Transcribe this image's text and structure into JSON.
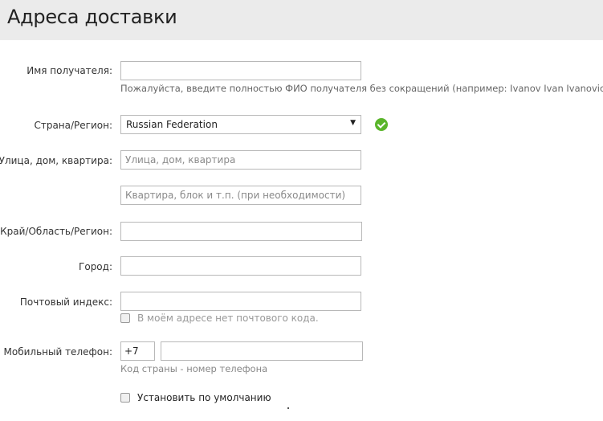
{
  "header": {
    "title": "Адреса доставки"
  },
  "form": {
    "recipient_label": "Имя получателя:",
    "recipient_value": "",
    "recipient_hint": "Пожалуйста, введите полностью ФИО получателя без сокращений (например: Ivanov Ivan Ivanovich).",
    "country_label": "Страна/Регион:",
    "country_value": "Russian Federation",
    "street_label": "Улица, дом, квартира:",
    "street_placeholder": "Улица, дом, квартира",
    "apartment_placeholder": "Квартира, блок и т.п. (при необходимости)",
    "region_label": "Край/Область/Регион:",
    "city_label": "Город:",
    "postal_label": "Почтовый индекс:",
    "no_postal_label": "В моём адресе нет почтового кода.",
    "phone_label": "Мобильный телефон:",
    "phone_code": "+7",
    "phone_hint": "Код страны - номер телефона",
    "default_label": "Установить по умолчанию"
  },
  "colors": {
    "header_bg": "#ebebeb",
    "valid_green": "#5ab52b"
  }
}
